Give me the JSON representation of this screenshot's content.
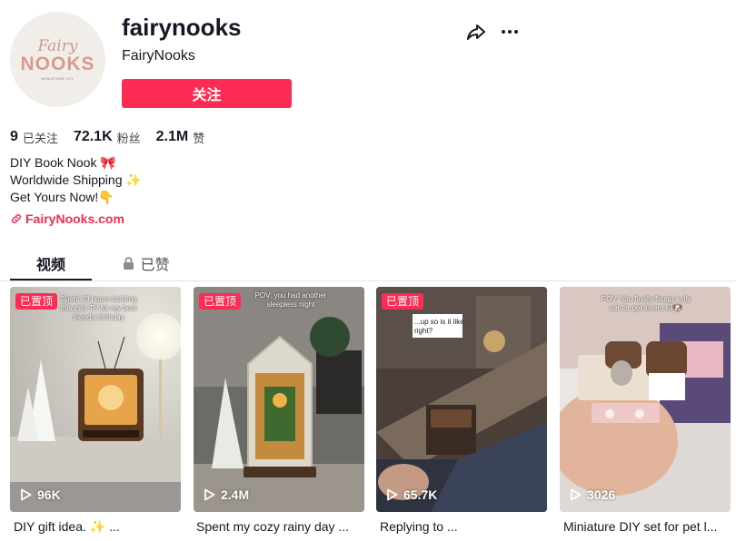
{
  "profile": {
    "avatar_line1": "Fairy",
    "avatar_line2": "NOOKS",
    "avatar_line3": "MINIATURE DIY",
    "username": "fairynooks",
    "nickname": "FairyNooks",
    "follow_label": "关注"
  },
  "stats": [
    {
      "value": "9",
      "label": "已关注"
    },
    {
      "value": "72.1K",
      "label": "粉丝"
    },
    {
      "value": "2.1M",
      "label": "赞"
    }
  ],
  "bio": [
    "DIY Book Nook 🎀",
    "Worldwide Shipping ✨",
    "Get Yours Now!👇"
  ],
  "link": "FairyNooks.com",
  "tabs": {
    "videos": "视频",
    "liked": "已赞"
  },
  "colors": {
    "accent": "#fe2c55",
    "text": "#161823"
  },
  "icons": [
    "share-icon",
    "more-icon",
    "link-icon",
    "lock-icon",
    "play-icon"
  ],
  "videos": [
    {
      "pinned": "已置顶",
      "overlay": "Spent 13 hours building this mini TV for my best friend's birthday",
      "views": "96K",
      "caption": "DIY gift idea. ✨ ..."
    },
    {
      "pinned": "已置顶",
      "overlay": "POV: you had another sleepless night",
      "views": "2.4M",
      "caption": "Spent my cozy rainy day ..."
    },
    {
      "pinned": "已置顶",
      "overlay": "...up so is it like right?",
      "views": "65.7K",
      "caption": "Replying to ..."
    },
    {
      "pinned": "",
      "overlay": "POV: You finally found a diy set for pet lovers 🐱🐶",
      "views": "3026",
      "caption": "Miniature DIY set for pet l..."
    }
  ]
}
